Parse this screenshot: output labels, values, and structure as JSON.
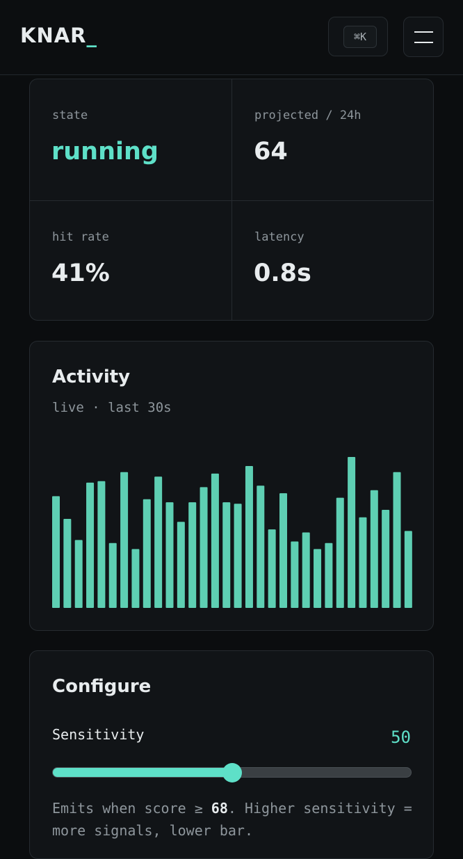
{
  "header": {
    "logo_text": "KNAR",
    "logo_cursor": "_",
    "command_shortcut": "⌘K",
    "menu_icon": "hamburger-icon"
  },
  "stats": [
    {
      "label": "state",
      "value": "running"
    },
    {
      "label": "projected / 24h",
      "value": "64"
    },
    {
      "label": "hit rate",
      "value": "41%"
    },
    {
      "label": "latency",
      "value": "0.8s"
    }
  ],
  "activity": {
    "title": "Activity",
    "subtitle": "live · last 30s"
  },
  "chart_data": {
    "type": "bar",
    "values": [
      74,
      59,
      45,
      83,
      84,
      43,
      90,
      39,
      72,
      87,
      70,
      57,
      70,
      80,
      89,
      70,
      69,
      94,
      81,
      52,
      76,
      44,
      50,
      39,
      43,
      73,
      100,
      60,
      78,
      65,
      90,
      51
    ],
    "color": "#5ecfb3",
    "xlabel": "",
    "ylabel": ""
  },
  "configure": {
    "title": "Configure",
    "sensitivity_label": "Sensitivity",
    "sensitivity_value": "50",
    "slider_fraction": 0.5,
    "helper_prefix": "Emits when score ≥ ",
    "helper_threshold": "68",
    "helper_suffix": ". Higher sensitivity = more signals, lower bar."
  },
  "colors": {
    "accent": "#5ee0c8",
    "background": "#0b0d0f",
    "card": "#111417",
    "border": "#262b30"
  }
}
